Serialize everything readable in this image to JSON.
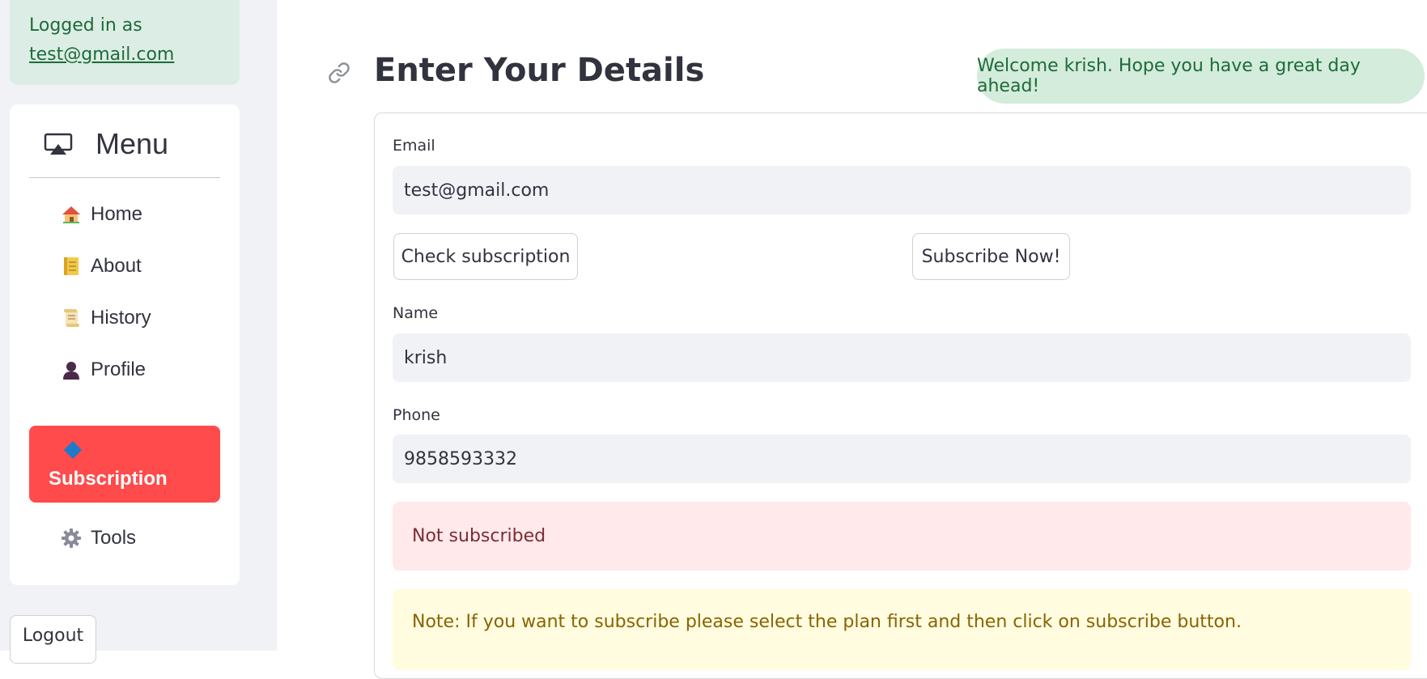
{
  "sidebar": {
    "login": {
      "prefix": "Logged in as",
      "email": "test@gmail.com"
    },
    "menu": {
      "title": "Menu",
      "icon": "airplay-icon",
      "items": [
        {
          "label": "Home",
          "icon": "house-icon"
        },
        {
          "label": "About",
          "icon": "notebook-icon"
        },
        {
          "label": "History",
          "icon": "scroll-icon"
        },
        {
          "label": "Profile",
          "icon": "person-icon"
        },
        {
          "label": "Subscription",
          "icon": "diamond-icon",
          "active": true
        },
        {
          "label": "Tools",
          "icon": "gear-icon"
        }
      ],
      "active_color": "#ff4b4b"
    },
    "logout_label": "Logout"
  },
  "main": {
    "title": "Enter Your Details",
    "toast": "Welcome krish. Hope you have a great day ahead!",
    "form": {
      "email": {
        "label": "Email",
        "value": "test@gmail.com"
      },
      "check_button": "Check subscription",
      "subscribe_button": "Subscribe Now!",
      "name": {
        "label": "Name",
        "value": "krish"
      },
      "phone": {
        "label": "Phone",
        "value": "9858593332"
      },
      "status": "Not subscribed",
      "note": "Note: If you want to subscribe please select the plan first and then click on subscribe button."
    }
  },
  "colors": {
    "sidebar_bg": "#f0f2f6",
    "success_bg": "#dcede5",
    "error_bg": "#ffe9ea",
    "warning_bg": "#fffce0"
  }
}
